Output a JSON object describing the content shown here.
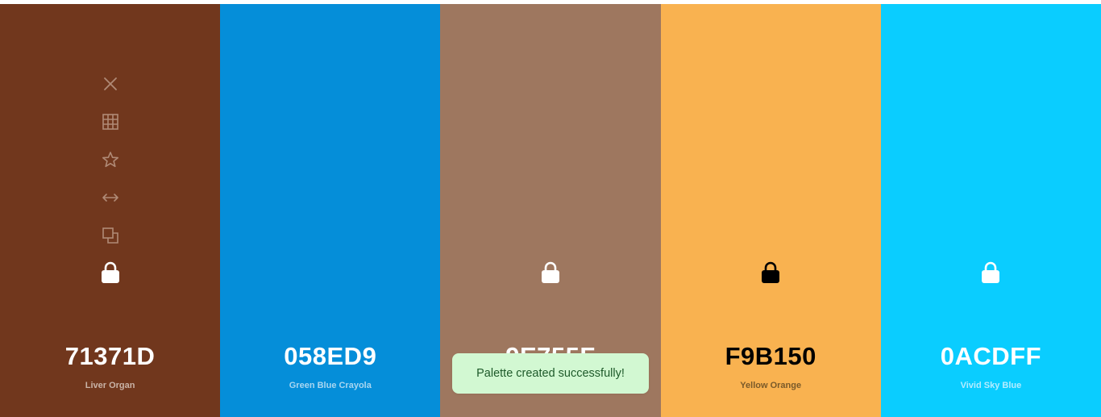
{
  "palette": {
    "colors": [
      {
        "hex": "71371D",
        "name": "Liver Organ",
        "background": "#71371d",
        "hex_color": "#ffffff",
        "name_color": "#c9b3a7",
        "lock_icon": "lock-icon",
        "lock_color": "#ffffff"
      },
      {
        "hex": "058ED9",
        "name": "Green Blue Crayola",
        "background": "#058ed9",
        "hex_color": "#ffffff",
        "name_color": "#a9d6f0",
        "lock_icon": "lock-icon",
        "lock_color": "#058ed9"
      },
      {
        "hex": "9E755F",
        "name": "",
        "background": "#9e775f",
        "hex_color": "#ffffff",
        "name_color": "#e0d2c8",
        "lock_icon": "lock-icon",
        "lock_color": "#ffffff"
      },
      {
        "hex": "F9B150",
        "name": "Yellow Orange",
        "background": "#f9b250",
        "hex_color": "#000000",
        "name_color": "#7a5a2a",
        "lock_icon": "lock-icon",
        "lock_color": "#000000"
      },
      {
        "hex": "0ACDFF",
        "name": "Vivid Sky Blue",
        "background": "#0acdff",
        "hex_color": "#ffffff",
        "name_color": "#b4ecff",
        "lock_icon": "lock-icon",
        "lock_color": "#ffffff"
      }
    ],
    "toolbar": {
      "icons": [
        "close-icon",
        "grid-icon",
        "star-icon",
        "drag-horizontal-icon",
        "copy-icon"
      ],
      "icon_color": "#b08a76"
    }
  },
  "toast": {
    "message": "Palette created successfully!"
  }
}
